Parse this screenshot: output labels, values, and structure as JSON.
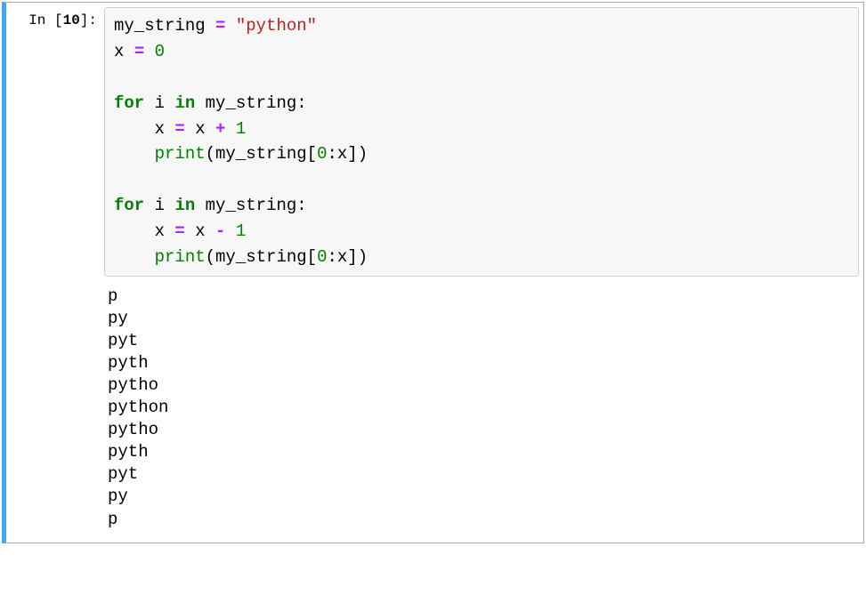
{
  "cell": {
    "prompt_label": "In [",
    "exec_count": "10",
    "prompt_close": "]:",
    "code": {
      "tokens": [
        {
          "t": "my_string",
          "c": "tok-name"
        },
        {
          "t": " ",
          "c": "tok-punc"
        },
        {
          "t": "=",
          "c": "tok-op"
        },
        {
          "t": " ",
          "c": "tok-punc"
        },
        {
          "t": "\"python\"",
          "c": "tok-str"
        },
        {
          "t": "\n",
          "c": "tok-punc"
        },
        {
          "t": "x",
          "c": "tok-name"
        },
        {
          "t": " ",
          "c": "tok-punc"
        },
        {
          "t": "=",
          "c": "tok-op"
        },
        {
          "t": " ",
          "c": "tok-punc"
        },
        {
          "t": "0",
          "c": "tok-num"
        },
        {
          "t": "\n",
          "c": "tok-punc"
        },
        {
          "t": "\n",
          "c": "tok-punc"
        },
        {
          "t": "for",
          "c": "tok-kw"
        },
        {
          "t": " ",
          "c": "tok-punc"
        },
        {
          "t": "i",
          "c": "tok-name"
        },
        {
          "t": " ",
          "c": "tok-punc"
        },
        {
          "t": "in",
          "c": "tok-kw"
        },
        {
          "t": " ",
          "c": "tok-punc"
        },
        {
          "t": "my_string",
          "c": "tok-name"
        },
        {
          "t": ":",
          "c": "tok-punc"
        },
        {
          "t": "\n",
          "c": "tok-punc"
        },
        {
          "t": "    ",
          "c": "tok-punc"
        },
        {
          "t": "x",
          "c": "tok-name"
        },
        {
          "t": " ",
          "c": "tok-punc"
        },
        {
          "t": "=",
          "c": "tok-op"
        },
        {
          "t": " ",
          "c": "tok-punc"
        },
        {
          "t": "x",
          "c": "tok-name"
        },
        {
          "t": " ",
          "c": "tok-punc"
        },
        {
          "t": "+",
          "c": "tok-op"
        },
        {
          "t": " ",
          "c": "tok-punc"
        },
        {
          "t": "1",
          "c": "tok-num"
        },
        {
          "t": "\n",
          "c": "tok-punc"
        },
        {
          "t": "    ",
          "c": "tok-punc"
        },
        {
          "t": "print",
          "c": "tok-bltn"
        },
        {
          "t": "(",
          "c": "tok-punc"
        },
        {
          "t": "my_string",
          "c": "tok-name"
        },
        {
          "t": "[",
          "c": "tok-punc"
        },
        {
          "t": "0",
          "c": "tok-num"
        },
        {
          "t": ":",
          "c": "tok-punc"
        },
        {
          "t": "x",
          "c": "tok-name"
        },
        {
          "t": "]",
          "c": "tok-punc"
        },
        {
          "t": ")",
          "c": "tok-punc"
        },
        {
          "t": "\n",
          "c": "tok-punc"
        },
        {
          "t": "    ",
          "c": "tok-punc"
        },
        {
          "t": "\n",
          "c": "tok-punc"
        },
        {
          "t": "for",
          "c": "tok-kw"
        },
        {
          "t": " ",
          "c": "tok-punc"
        },
        {
          "t": "i",
          "c": "tok-name"
        },
        {
          "t": " ",
          "c": "tok-punc"
        },
        {
          "t": "in",
          "c": "tok-kw"
        },
        {
          "t": " ",
          "c": "tok-punc"
        },
        {
          "t": "my_string",
          "c": "tok-name"
        },
        {
          "t": ":",
          "c": "tok-punc"
        },
        {
          "t": "\n",
          "c": "tok-punc"
        },
        {
          "t": "    ",
          "c": "tok-punc"
        },
        {
          "t": "x",
          "c": "tok-name"
        },
        {
          "t": " ",
          "c": "tok-punc"
        },
        {
          "t": "=",
          "c": "tok-op"
        },
        {
          "t": " ",
          "c": "tok-punc"
        },
        {
          "t": "x",
          "c": "tok-name"
        },
        {
          "t": " ",
          "c": "tok-punc"
        },
        {
          "t": "-",
          "c": "tok-op"
        },
        {
          "t": " ",
          "c": "tok-punc"
        },
        {
          "t": "1",
          "c": "tok-num"
        },
        {
          "t": "\n",
          "c": "tok-punc"
        },
        {
          "t": "    ",
          "c": "tok-punc"
        },
        {
          "t": "print",
          "c": "tok-bltn"
        },
        {
          "t": "(",
          "c": "tok-punc"
        },
        {
          "t": "my_string",
          "c": "tok-name"
        },
        {
          "t": "[",
          "c": "tok-punc"
        },
        {
          "t": "0",
          "c": "tok-num"
        },
        {
          "t": ":",
          "c": "tok-punc"
        },
        {
          "t": "x",
          "c": "tok-name"
        },
        {
          "t": "]",
          "c": "tok-punc"
        },
        {
          "t": ")",
          "c": "tok-punc"
        }
      ]
    },
    "output_lines": [
      "p",
      "py",
      "pyt",
      "pyth",
      "pytho",
      "python",
      "pytho",
      "pyth",
      "pyt",
      "py",
      "p",
      ""
    ]
  }
}
